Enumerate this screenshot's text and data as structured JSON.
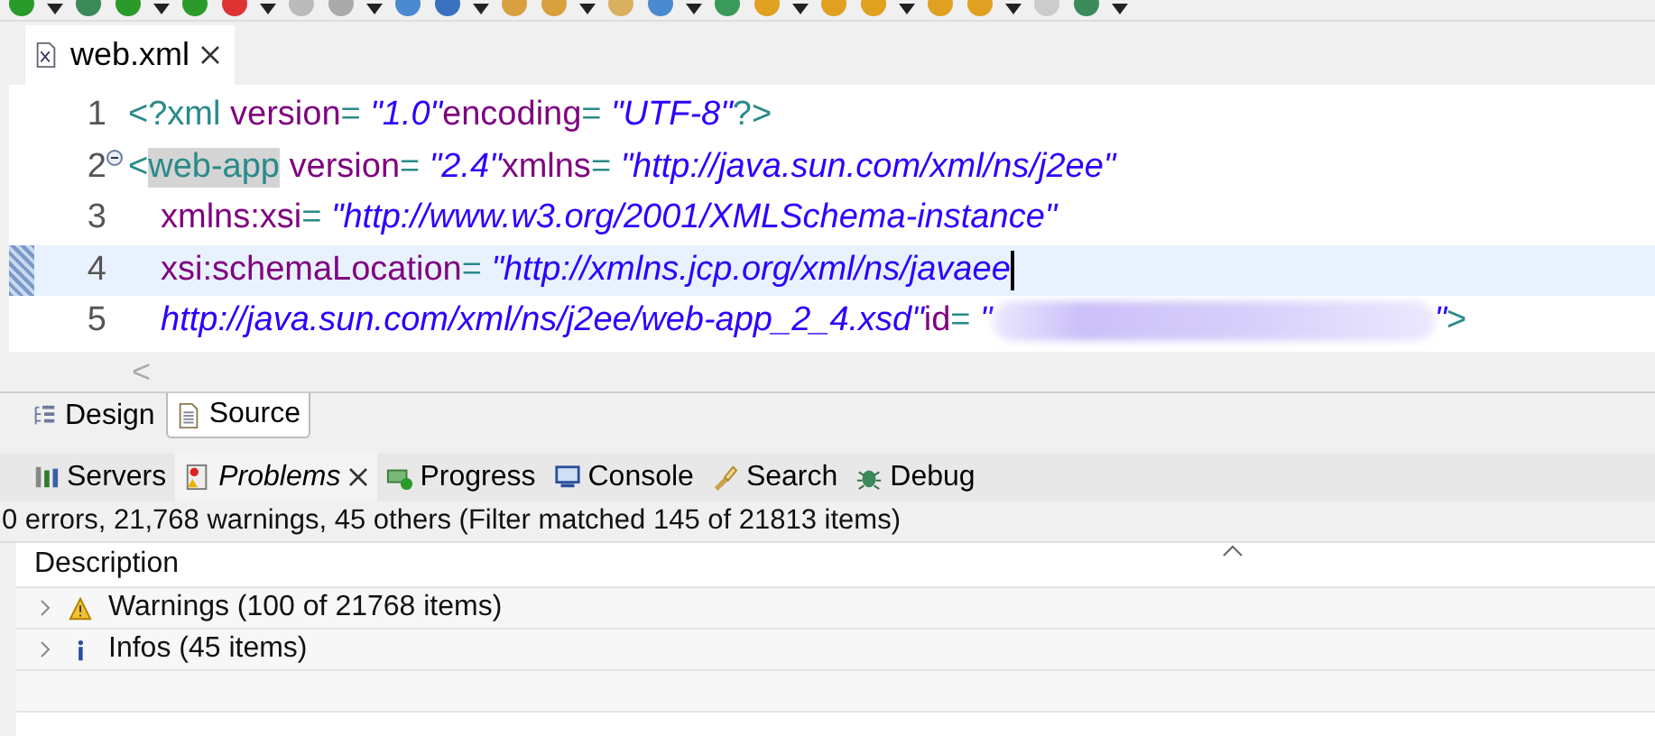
{
  "editor": {
    "tabs": [
      {
        "title": "web.xml",
        "selected": true
      }
    ],
    "lines": [
      {
        "number": "1",
        "current": false,
        "foldable": false,
        "indent": false,
        "tokens": [
          {
            "kind": "punct",
            "text": "<?"
          },
          {
            "kind": "tag",
            "text": "xml"
          },
          {
            "kind": "attr",
            "text": " version"
          },
          {
            "kind": "punct",
            "text": "= "
          },
          {
            "kind": "value",
            "text": "\"1.0\""
          },
          {
            "kind": "attr",
            "text": "encoding"
          },
          {
            "kind": "punct",
            "text": "= "
          },
          {
            "kind": "value",
            "text": "\"UTF-8\""
          },
          {
            "kind": "punct",
            "text": "?>"
          }
        ]
      },
      {
        "number": "2",
        "current": false,
        "foldable": true,
        "indent": false,
        "tokens": [
          {
            "kind": "punct",
            "text": "<"
          },
          {
            "kind": "tag-match",
            "text": "web-app"
          },
          {
            "kind": "attr",
            "text": " version"
          },
          {
            "kind": "punct",
            "text": "= "
          },
          {
            "kind": "value",
            "text": "\"2.4\""
          },
          {
            "kind": "attr",
            "text": "xmlns"
          },
          {
            "kind": "punct",
            "text": "= "
          },
          {
            "kind": "value",
            "text": "\"http://java.sun.com/xml/ns/j2ee\""
          }
        ]
      },
      {
        "number": "3",
        "current": false,
        "foldable": false,
        "indent": true,
        "tokens": [
          {
            "kind": "attr",
            "text": "xmlns:xsi"
          },
          {
            "kind": "punct",
            "text": "= "
          },
          {
            "kind": "value",
            "text": "\"http://www.w3.org/2001/XMLSchema-instance\""
          }
        ]
      },
      {
        "number": "4",
        "current": true,
        "foldable": false,
        "indent": true,
        "tokens": [
          {
            "kind": "attr",
            "text": "xsi:schemaLocation"
          },
          {
            "kind": "punct",
            "text": "= "
          },
          {
            "kind": "value",
            "text": "\"http://xmlns.jcp.org/xml/ns/javaee"
          },
          {
            "kind": "cursor"
          }
        ]
      },
      {
        "number": "5",
        "current": false,
        "foldable": false,
        "indent": true,
        "tokens": [
          {
            "kind": "value",
            "text": "http://java.sun.com/xml/ns/j2ee/web-app_2_4.xsd\""
          },
          {
            "kind": "attr",
            "text": "id"
          },
          {
            "kind": "punct",
            "text": "= "
          },
          {
            "kind": "value",
            "text": "\""
          },
          {
            "kind": "redacted"
          },
          {
            "kind": "value",
            "text": "\""
          },
          {
            "kind": "punct",
            "text": ">"
          }
        ]
      }
    ],
    "scroll_left": "<",
    "mode_tabs": [
      {
        "label": "Design",
        "selected": false
      },
      {
        "label": "Source",
        "selected": true
      }
    ]
  },
  "views": {
    "tabs": [
      {
        "label": "Servers",
        "selected": false
      },
      {
        "label": "Problems",
        "selected": true
      },
      {
        "label": "Progress",
        "selected": false
      },
      {
        "label": "Console",
        "selected": false
      },
      {
        "label": "Search",
        "selected": false
      },
      {
        "label": "Debug",
        "selected": false
      }
    ],
    "status": "0 errors, 21,768 warnings, 45 others (Filter matched 145 of 21813 items)",
    "columns": [
      "Description"
    ],
    "rows": [
      {
        "label": "Warnings (100 of 21768 items)",
        "kind": "warning",
        "expanded": false
      },
      {
        "label": "Infos (45 items)",
        "kind": "info",
        "expanded": false
      }
    ]
  }
}
